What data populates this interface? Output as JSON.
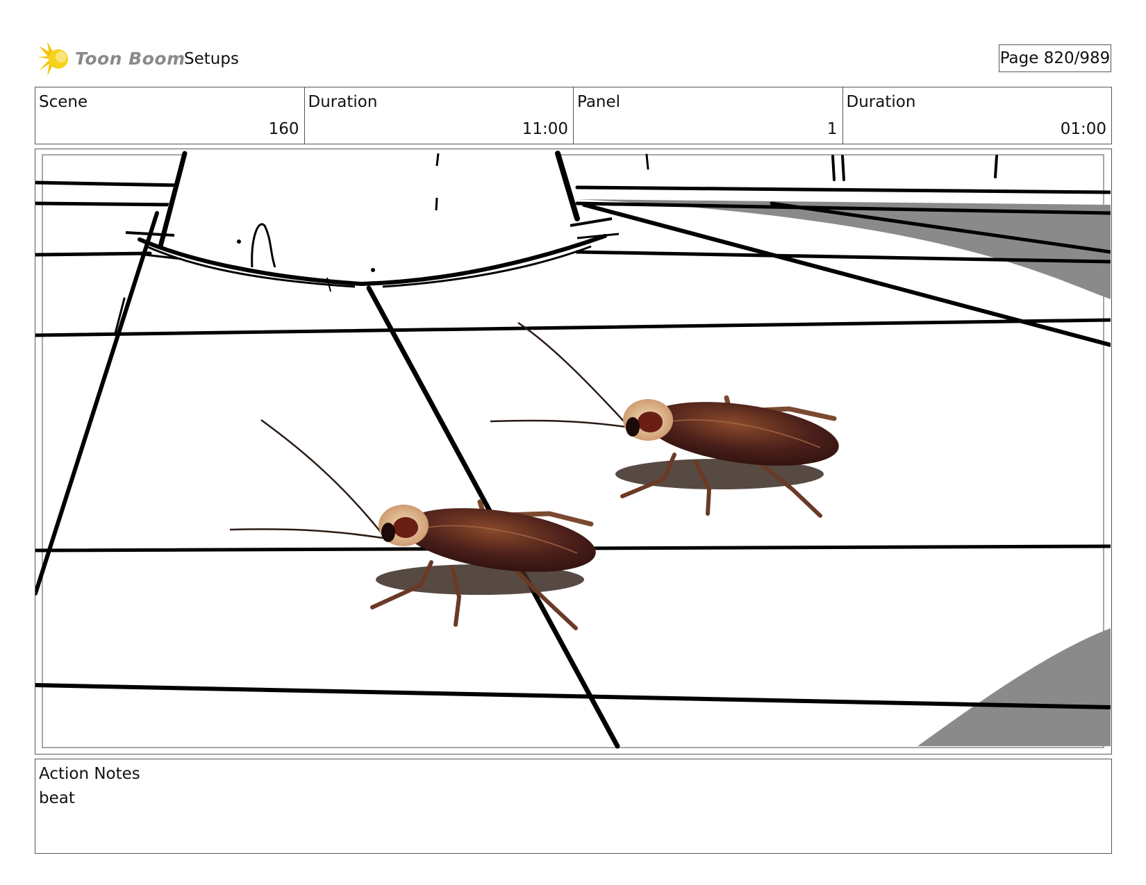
{
  "header": {
    "logo_text": "Toon Boom",
    "section_title": "Setups",
    "page_label": "Page 820/989"
  },
  "info": {
    "scene_label": "Scene",
    "scene_value": "160",
    "scene_duration_label": "Duration",
    "scene_duration_value": "11:00",
    "panel_label": "Panel",
    "panel_value": "1",
    "panel_duration_label": "Duration",
    "panel_duration_value": "01:00"
  },
  "panel_image": {
    "subject": "two cockroaches on a tiled floor near a toilet base",
    "accent_colors": {
      "roach_body": "#4a1f1a",
      "roach_highlight": "#8a4a2a",
      "roach_head": "#e8c9a0",
      "shadow_gray": "#8a8a8a",
      "logo_yellow": "#f5c400"
    }
  },
  "notes": {
    "label": "Action Notes",
    "text": "beat"
  }
}
